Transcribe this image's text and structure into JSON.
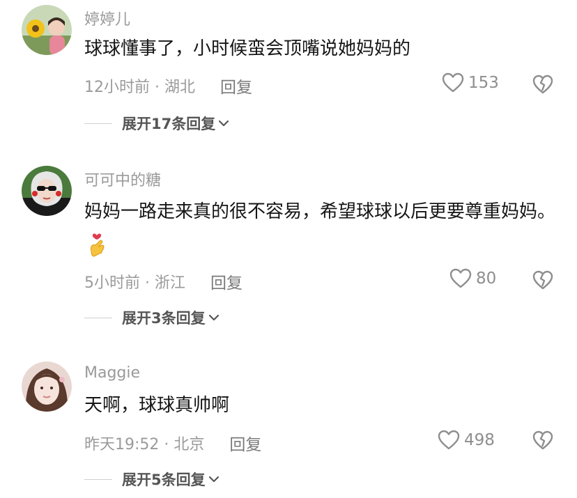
{
  "comments": [
    {
      "username": "婷婷儿",
      "text": "球球懂事了，小时候蛮会顶嘴说她妈妈的",
      "time_location": "12小时前 · 湖北",
      "reply_label": "回复",
      "likes": "153",
      "expand_label": "展开17条回复"
    },
    {
      "username": "可可中的糖",
      "text": "妈妈一路走来真的很不容易，希望球球以后更要尊重妈妈。",
      "time_location": "5小时前 · 浙江",
      "reply_label": "回复",
      "likes": "80",
      "expand_label": "展开3条回复"
    },
    {
      "username": "Maggie",
      "text": "天啊，球球真帅啊",
      "time_location": "昨天19:52 · 北京",
      "reply_label": "回复",
      "likes": "498",
      "expand_label": "展开5条回复"
    }
  ],
  "icons": {
    "like": "heart-outline-icon",
    "dislike": "broken-heart-icon",
    "expand": "chevron-down-icon",
    "emoji": "finger-heart-emoji"
  },
  "colors": {
    "text": "#161616",
    "meta": "#9a9a9a",
    "expand": "#555555"
  }
}
